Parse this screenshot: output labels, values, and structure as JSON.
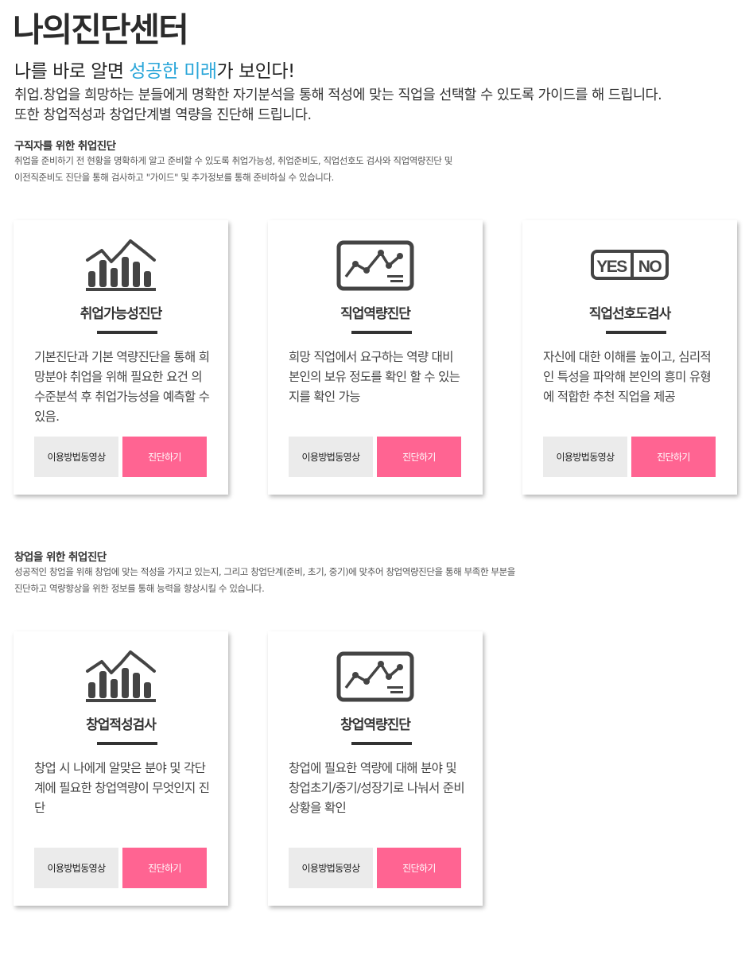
{
  "header": {
    "title": "나의진단센터",
    "headline_pre": "나를 바로 알면 ",
    "headline_accent": "성공한 미래",
    "headline_post": "가 보인다!",
    "intro_line1": "취업.창업을 희망하는 분들에게 명확한 자기분석을 통해 적성에 맞는 직업을 선택할 수 있도록 가이드를 해 드립니다.",
    "intro_line2": "또한 창업적성과 창업단계별 역량을 진단해 드립니다."
  },
  "sections": [
    {
      "title": "구직자를 위한 취업진단",
      "desc_line1": "취업을 준비하기 전 현황을 명확하게 알고 준비할 수 있도록 취업가능성, 취업준비도, 직업선호도 검사와 직업역량진단 및",
      "desc_line2": "이전직준비도 진단을 통해 검사하고 \"가이드\" 및 추가정보를 통해 준비하실 수 있습니다.",
      "cards": [
        {
          "icon": "bar-chart-icon",
          "title": "취업가능성진단",
          "desc": "기본진단과 기본 역량진단을 통해 희망분야 취업을 위해 필요한 요건 의수준분석 후 취업가능성을 예측할 수 있음.",
          "video_label": "이용방법동영상",
          "diag_label": "진단하기"
        },
        {
          "icon": "line-chart-icon",
          "title": "직업역량진단",
          "desc": "희망 직업에서 요구하는 역량 대비 본인의 보유 정도를 확인 할 수 있는지를 확인 가능",
          "video_label": "이용방법동영상",
          "diag_label": "진단하기"
        },
        {
          "icon": "yes-no-icon",
          "title": "직업선호도검사",
          "desc": "자신에 대한 이해를 높이고, 심리적인 특성을 파악해 본인의 흥미 유형에 적합한 추천 직업을 제공",
          "video_label": "이용방법동영상",
          "diag_label": "진단하기"
        }
      ]
    },
    {
      "title": "창업을 위한 취업진단",
      "desc_line1": "성공적인 창업을 위해 창업에 맞는 적성을 가지고 있는지, 그리고 창업단계(준비, 초기, 중기)에 맞추어 창업역량진단을 통해 부족한 부분을",
      "desc_line2": "진단하고 역량향상을 위한 정보를 통해 능력을 향상시킬 수 있습니다.",
      "cards": [
        {
          "icon": "bar-chart-icon",
          "title": "창업적성검사",
          "desc": "창업 시 나에게 알맞은 분야 및 각단계에 필요한 창업역량이 무엇인지 진\n단",
          "video_label": "이용방법동영상",
          "diag_label": "진단하기"
        },
        {
          "icon": "line-chart-icon",
          "title": "창업역량진단",
          "desc": "창업에 필요한 역량에 대해 분야 및 창업초기/중기/성장기로 나눠서 준비 상황을 확인",
          "video_label": "이용방법동영상",
          "diag_label": "진단하기"
        }
      ]
    }
  ]
}
